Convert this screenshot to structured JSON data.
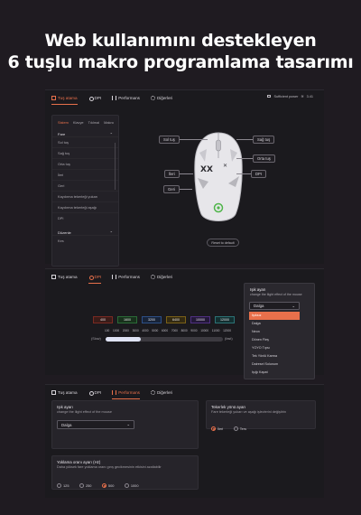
{
  "hero": {
    "line1": "Web kullanımını destekleyen",
    "line2": "6 tuşlu makro programlama tasarımı"
  },
  "tabs": [
    "Tuş atama",
    "DPI",
    "Performans",
    "Diğerleri"
  ],
  "status": {
    "power": "Sufficient power",
    "version": "3.41"
  },
  "sidebar": {
    "subtabs": [
      "Sistem",
      "Klavye",
      "Tıklmal",
      "Makro"
    ],
    "sec1": "Fare",
    "items": [
      "Sol tuş",
      "Sağ tuş",
      "Orta tuş",
      "İleri",
      "Geri",
      "Kaydırma tekerleği yukarı",
      "Kaydırma tekerleği aşağı",
      "DPI"
    ],
    "sec2": "Düzenle",
    "items2": [
      "Kes"
    ]
  },
  "callouts": {
    "left": "Sol tuş",
    "right": "Sağ tuş",
    "middle": "Orta tuş",
    "forward": "İleri",
    "back": "Geri",
    "dpi": "DPI"
  },
  "reset": "Reset to default",
  "dpi": {
    "chips": [
      "400",
      "1600",
      "3200",
      "6400",
      "10000",
      "12000"
    ],
    "chip_colors": [
      "#d33a2a",
      "#34a853",
      "#2f6fd1",
      "#e0a11c",
      "#7b3fd1",
      "#3ab0b5"
    ],
    "ticks": [
      "100",
      "1000",
      "2000",
      "3000",
      "4000",
      "5000",
      "6000",
      "7000",
      "8000",
      "9000",
      "10000",
      "11000",
      "12000"
    ],
    "slow": "(Slow)",
    "fast": "(fast)",
    "value_fraction": 0.3
  },
  "light": {
    "title": "Işık ayarı",
    "subtitle": "change the llight effect of the mouse",
    "selected": "Dalga",
    "options": [
      "Işıksız",
      "Dalga",
      "Neon",
      "Dönen Fleş",
      "YOYO Tıpsı",
      "Tek Yönlü Karma",
      "Dairesel Solunum",
      "Işığı Kapat"
    ]
  },
  "scroll": {
    "title": "Tekerlek yönü ayarı",
    "subtitle": "Fare tekerleği yukarı ve aşağı işlevlerini değiştirin",
    "options": [
      "İleri",
      "Ters"
    ]
  },
  "polling": {
    "title": "Yoklama oranı ayarı (Hz)",
    "subtitle": "Daha yüksek fare yoklama oranı gırış gecikmesinin etkisini azaltabilir",
    "options": [
      "125",
      "250",
      "500",
      "1000"
    ],
    "selected": "500"
  },
  "colors": {
    "accent": "#e8704b",
    "background": "#1f1b21"
  }
}
